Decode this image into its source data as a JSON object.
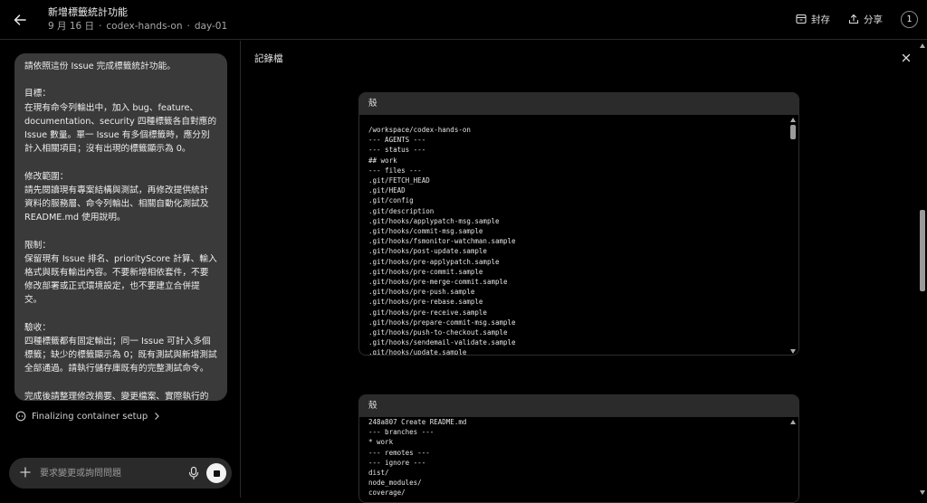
{
  "header": {
    "title": "新增標籤統計功能",
    "date": "9 月 16 日",
    "repo": "codex-hands-on",
    "branch": "day-01",
    "separator": "·",
    "archive_label": "封存",
    "share_label": "分享",
    "notification_count": "1"
  },
  "chat": {
    "message": "請依照這份 Issue 完成標籤統計功能。\n\n目標：\n在現有命令列輸出中，加入 bug、feature、documentation、security 四種標籤各自對應的 Issue 數量。單一 Issue 有多個標籤時，應分別計入相關項目；沒有出現的標籤顯示為 0。\n\n修改範圍：\n請先閱讀現有專案結構與測試，再修改提供統計資料的服務層、命令列輸出、相關自動化測試及 README.md 使用說明。\n\n限制：\n保留現有 Issue 排名、priorityScore 計算、輸入格式與既有輸出內容。不要新增相依套件，不要修改部署或正式環境設定，也不要建立合併提交。\n\n驗收：\n四種標籤都有固定輸出；同一 Issue 可計入多個標籤；缺少的標籤顯示為 0；既有測試與新增測試全部通過。請執行儲存庫既有的完整測試命令。\n\n完成後請整理修改摘要、變更檔案、實際執行的測試與結果，並建立 PR 草稿。\n\n若 Issue 描述與現有程式衝突，先說明衝突，不要自行改變既有行為。",
    "status_text": "Finalizing container setup",
    "composer_placeholder": "要求變更或詢問問題"
  },
  "panel": {
    "title": "記錄檔",
    "shells": [
      {
        "label": "殼",
        "lines": [
          "/workspace/codex-hands-on",
          "--- AGENTS ---",
          "--- status ---",
          "## work",
          "--- files ---",
          ".git/FETCH_HEAD",
          ".git/HEAD",
          ".git/config",
          ".git/description",
          ".git/hooks/applypatch-msg.sample",
          ".git/hooks/commit-msg.sample",
          ".git/hooks/fsmonitor-watchman.sample",
          ".git/hooks/post-update.sample",
          ".git/hooks/pre-applypatch.sample",
          ".git/hooks/pre-commit.sample",
          ".git/hooks/pre-merge-commit.sample",
          ".git/hooks/pre-push.sample",
          ".git/hooks/pre-rebase.sample",
          ".git/hooks/pre-receive.sample",
          ".git/hooks/prepare-commit-msg.sample",
          ".git/hooks/push-to-checkout.sample",
          ".git/hooks/sendemail-validate.sample",
          ".git/hooks/update.sample"
        ]
      },
      {
        "label": "殼",
        "lines": [
          "248a807 Create README.md",
          "--- branches ---",
          "* work",
          "--- remotes ---",
          "--- ignore ---",
          "dist/",
          "node_modules/",
          "coverage/"
        ]
      }
    ]
  },
  "colors": {
    "background": "#000000",
    "bubble": "#3a3a3a",
    "shell_header": "#2b2b2b",
    "text": "#e6e6e6"
  }
}
